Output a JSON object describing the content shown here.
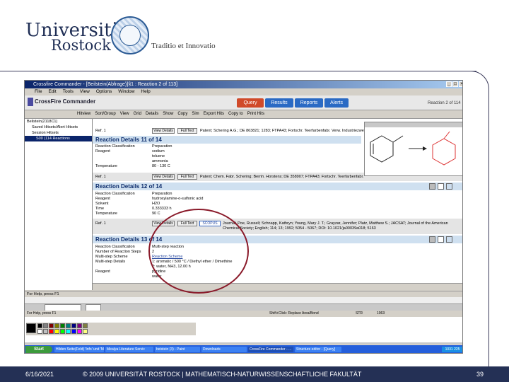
{
  "branding": {
    "university": "Universität",
    "city": "Rostock",
    "motto": "Traditio et Innovatio"
  },
  "app": {
    "window_title": "Crossfire Commander - [Beilstein(Abfrage)]§1 : Reaction 2 of 113]",
    "menu": [
      "File",
      "Edit",
      "Tools",
      "View",
      "Options",
      "Window",
      "Help"
    ],
    "brand_name": "CrossFire Commander",
    "nav_tabs": [
      {
        "label": "Query",
        "color": "#d04a2a"
      },
      {
        "label": "Results",
        "color": "#2a6ac4"
      },
      {
        "label": "Reports",
        "color": "#2a6ac4"
      },
      {
        "label": "Alerts",
        "color": "#2a6ac4"
      }
    ],
    "reaction_counter": "Reaction 2 of 114",
    "toolbar": [
      "Hitview",
      "Sort/Group",
      "View",
      "Grid",
      "Details",
      "Show",
      "Copy",
      "Sim",
      "Export Hits",
      "Copy to",
      "Print Hits"
    ],
    "tree": {
      "root": "Beilstein(2118C1)",
      "items": [
        "Saved Hitsets/Alert Hitsets",
        "Session Hitsets",
        "S00 (114 Reactions"
      ]
    },
    "status_help": "For Help, press F1",
    "status_shift": "Shift+Click: Replace Area/Bond",
    "taskbar": {
      "start": "Start",
      "buttons": [
        "Hilden Seite(Feld) 'Info' und 'Möbleinheit'",
        "Mealya Literature Servic",
        "beistein (3) - Paint",
        "Downloads",
        "CrossFire Commander - ...",
        "Structure editor - [Query]"
      ],
      "clock": "1031 225"
    }
  },
  "ref1_top": {
    "ref_label": "Ref. 1",
    "view_details": "View Details",
    "full_text": "Full Text",
    "citation": "Patent; Schering A.G.; DE 863821; 1283; FTPA43; Fortschr. Teerfarbenfabr. Verw. Industriezweige"
  },
  "details11": {
    "title": "Reaction Details 11 of 14",
    "rows": [
      {
        "label": "Reaction Classification",
        "value": "Preparation"
      },
      {
        "label": "Reagent",
        "value": "sodium"
      },
      {
        "label": "",
        "value": "toluene"
      },
      {
        "label": "",
        "value": "ammonia"
      },
      {
        "label": "Temperature",
        "value": "80 - 130 C"
      }
    ]
  },
  "ref1_mid": {
    "ref_label": "Ref. 1",
    "view_details": "View Details",
    "full_text": "Full Text",
    "citation": "Patent; Chem. Fabr. Schering; Bernh. Horstens; DE 358907; FTPA43; Fortschr. Teerfarbenfabr."
  },
  "details12": {
    "title": "Reaction Details 12 of 14",
    "rows": [
      {
        "label": "Reaction Classification",
        "value": "Preparation"
      },
      {
        "label": "Reagent",
        "value": "hydroxylamine-o-sulfonic acid"
      },
      {
        "label": "Solvent",
        "value": "H2O"
      },
      {
        "label": "Time",
        "value": "0.333333 h"
      },
      {
        "label": "Temperature",
        "value": "90 C"
      }
    ]
  },
  "ref1_low": {
    "ref_label": "Ref. 1",
    "view_details": "View Details",
    "full_text": "Full Text",
    "scopus": "SCOPUS",
    "citation": "Journal; Poe, Russell; Schnapp, Kathryn; Young, Mary J. T.; Grayzar, Jennifer; Platz, Matthew S.; JACSAT; Journal of the American Chemical Society; English; 114; 13; 1992; 5054 - 5067; DOI: 10.1021/ja00039a018; 5163"
  },
  "details13": {
    "title": "Reaction Details 13 of 14",
    "rows": [
      {
        "label": "Reaction Classification",
        "value": "Multi-step reaction"
      },
      {
        "label": "Number of Reaction Steps",
        "value": "2"
      },
      {
        "label": "Multi-step Scheme",
        "value": "Reaction Scheme"
      },
      {
        "label": "Multi-step Details",
        "value": "1: aromatic / 500 °C / Diethyl ether / Dimethine"
      },
      {
        "label": "",
        "value": "2: water, NH3, 12.00 h"
      },
      {
        "label": "Reagent",
        "value": "pyridine"
      },
      {
        "label": "",
        "value": "water"
      }
    ]
  },
  "paint_status": {
    "help": "For Help, press F1",
    "coords": "STR",
    "count": "1063"
  },
  "footer": {
    "date": "6/16/2021",
    "copyright": "© 2009 UNIVERSITÄT ROSTOCK | MATHEMATISCH-NATURWISSENSCHAFTLICHE FAKULTÄT",
    "page": "39"
  }
}
